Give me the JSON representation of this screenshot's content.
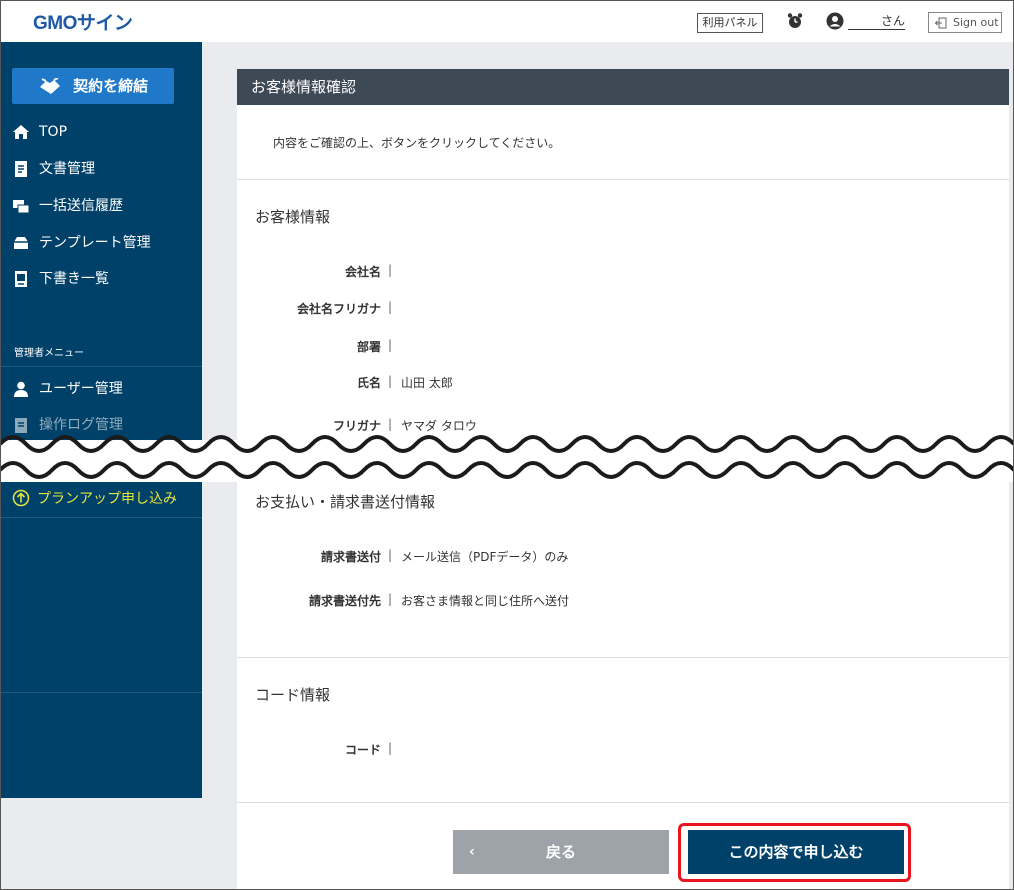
{
  "header": {
    "logo": "GMOサイン",
    "panel_button": "利用パネル",
    "username": "さん",
    "signout": "Sign out"
  },
  "sidebar": {
    "contract_button": "契約を締結",
    "items": [
      {
        "label": "TOP",
        "icon": "home-icon"
      },
      {
        "label": "文書管理",
        "icon": "document-icon"
      },
      {
        "label": "一括送信履歴",
        "icon": "bulk-send-icon"
      },
      {
        "label": "テンプレート管理",
        "icon": "template-icon"
      },
      {
        "label": "下書き一覧",
        "icon": "draft-icon"
      }
    ],
    "admin_section": "管理者メニュー",
    "admin_items": [
      {
        "label": "ユーザー管理",
        "icon": "user-icon"
      },
      {
        "label": "操作ログ管理",
        "icon": "log-icon"
      }
    ],
    "plan_up": "プランアップ申し込み"
  },
  "main": {
    "title": "お客様情報確認",
    "intro": "内容をご確認の上、ボタンをクリックしてください。",
    "customer_section": {
      "title": "お客様情報",
      "fields": [
        {
          "label": "会社名",
          "value": ""
        },
        {
          "label": "会社名フリガナ",
          "value": ""
        },
        {
          "label": "部署",
          "value": ""
        },
        {
          "label": "氏名",
          "value": "山田 太郎"
        },
        {
          "label": "フリガナ",
          "value": "ヤマダ タロウ"
        }
      ]
    },
    "payment_section": {
      "title": "お支払い・請求書送付情報",
      "fields": [
        {
          "label": "請求書送付",
          "value": "メール送信（PDFデータ）のみ"
        },
        {
          "label": "請求書送付先",
          "value": "お客さま情報と同じ住所へ送付"
        }
      ]
    },
    "code_section": {
      "title": "コード情報",
      "fields": [
        {
          "label": "コード",
          "value": ""
        }
      ]
    },
    "back_button": "戻る",
    "submit_button": "この内容で申し込む"
  },
  "colors": {
    "sidebar": "#00416a",
    "accent": "#1f78c8",
    "highlight": "#e8141e",
    "plan": "#e5e53a"
  }
}
